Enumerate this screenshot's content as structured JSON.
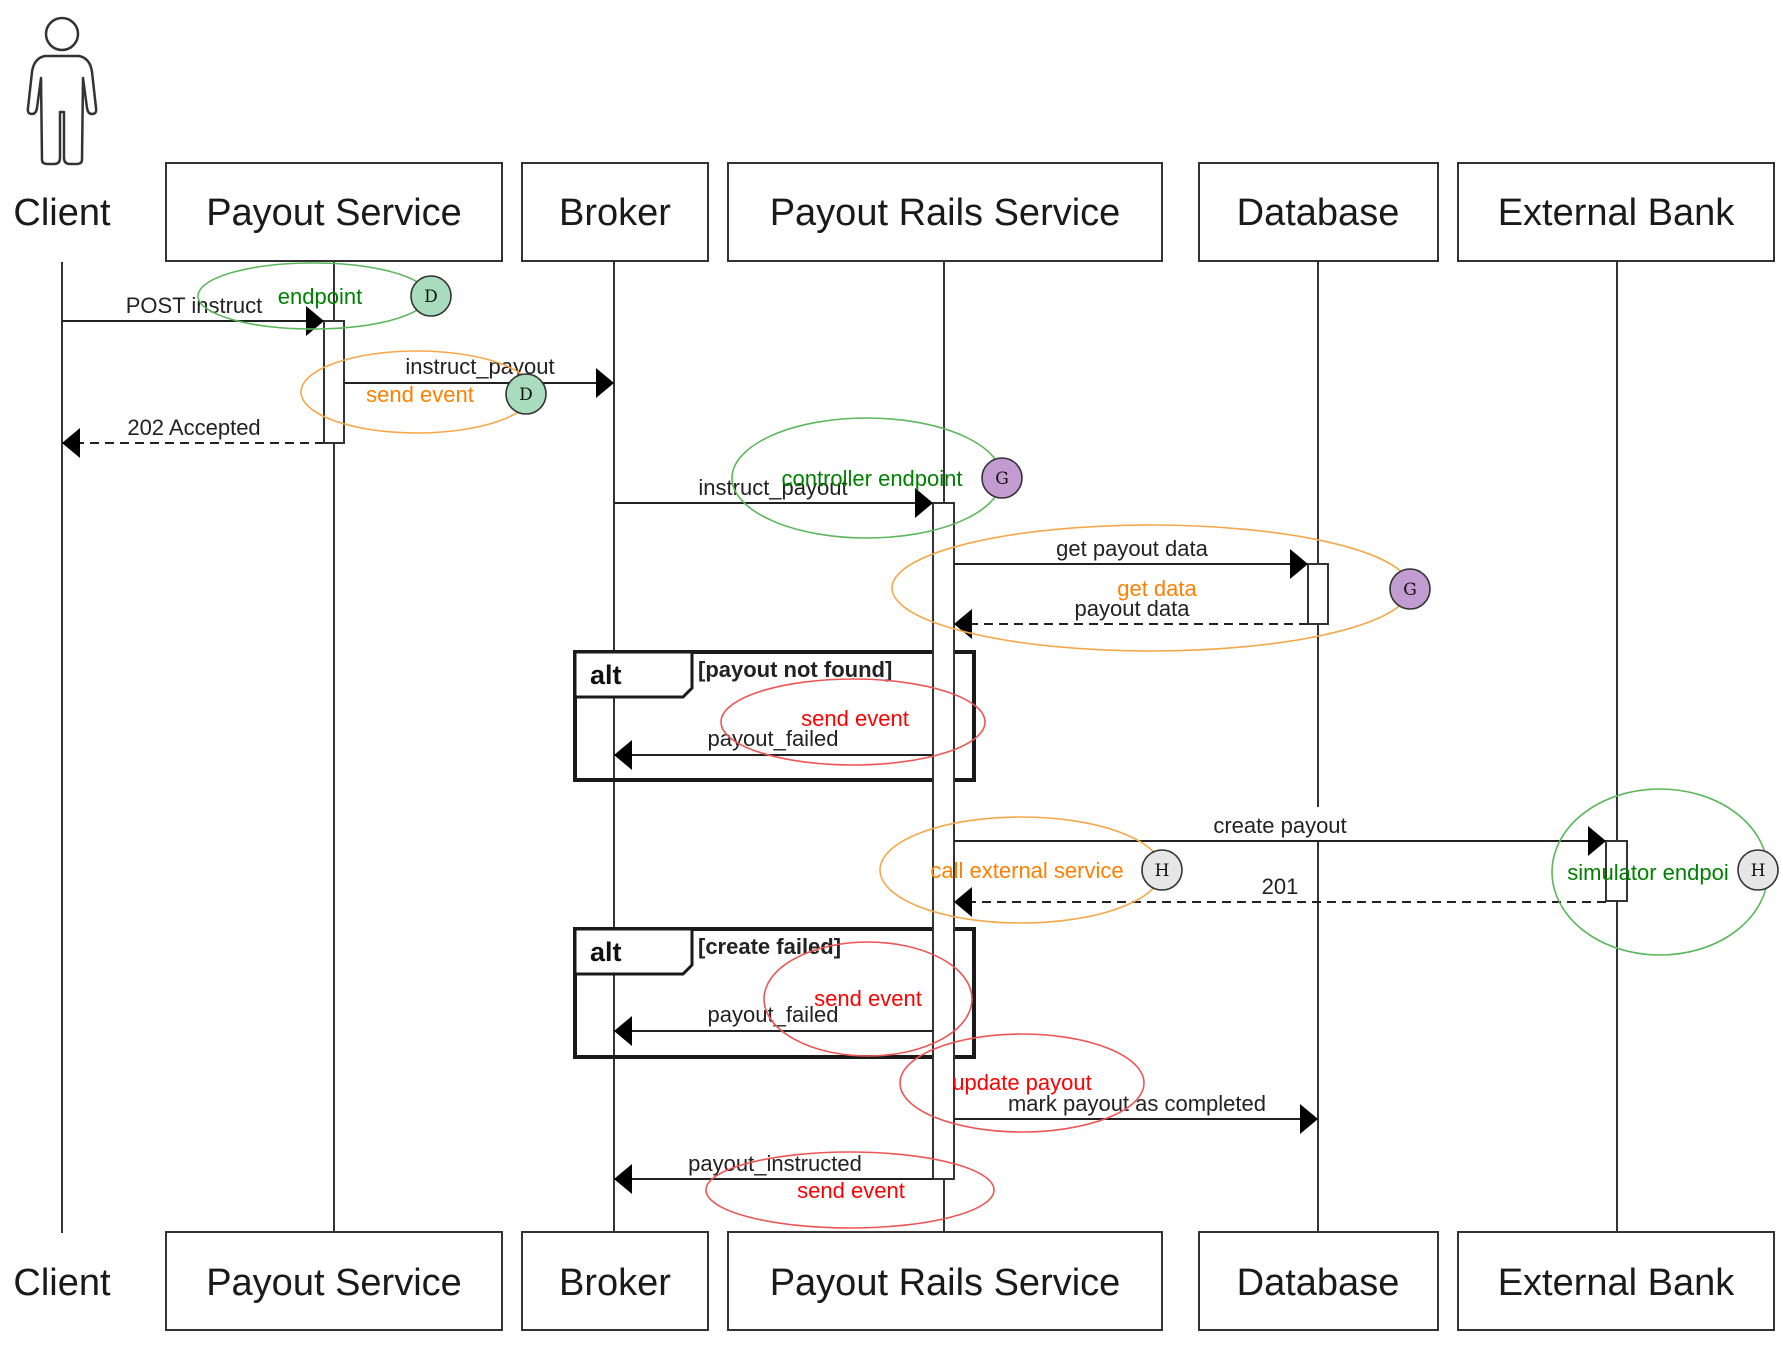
{
  "diagram": {
    "type": "sequence",
    "participants": [
      {
        "id": "client",
        "label": "Client",
        "kind": "actor"
      },
      {
        "id": "payout_service",
        "label": "Payout Service",
        "kind": "box"
      },
      {
        "id": "broker",
        "label": "Broker",
        "kind": "box"
      },
      {
        "id": "payout_rails",
        "label": "Payout Rails Service",
        "kind": "box"
      },
      {
        "id": "database",
        "label": "Database",
        "kind": "box"
      },
      {
        "id": "external_bank",
        "label": "External Bank",
        "kind": "box"
      }
    ],
    "messages": [
      {
        "from": "client",
        "to": "payout_service",
        "label": "POST instruct",
        "style": "solid"
      },
      {
        "from": "payout_service",
        "to": "broker",
        "label": "instruct_payout",
        "style": "solid"
      },
      {
        "from": "payout_service",
        "to": "client",
        "label": "202 Accepted",
        "style": "dashed"
      },
      {
        "from": "broker",
        "to": "payout_rails",
        "label": "instruct_payout",
        "style": "solid"
      },
      {
        "from": "payout_rails",
        "to": "database",
        "label": "get payout data",
        "style": "solid"
      },
      {
        "from": "database",
        "to": "payout_rails",
        "label": "payout data",
        "style": "dashed"
      },
      {
        "from": "payout_rails",
        "to": "broker",
        "label": "payout_failed",
        "style": "solid",
        "frame": 0
      },
      {
        "from": "payout_rails",
        "to": "external_bank",
        "label": "create payout",
        "style": "solid"
      },
      {
        "from": "external_bank",
        "to": "payout_rails",
        "label": "201",
        "style": "dashed"
      },
      {
        "from": "payout_rails",
        "to": "broker",
        "label": "payout_failed",
        "style": "solid",
        "frame": 1
      },
      {
        "from": "payout_rails",
        "to": "database",
        "label": "mark payout as completed",
        "style": "solid"
      },
      {
        "from": "payout_rails",
        "to": "broker",
        "label": "payout_instructed",
        "style": "solid"
      }
    ],
    "frames": [
      {
        "operator": "alt",
        "guard": "[payout not found]"
      },
      {
        "operator": "alt",
        "guard": "[create failed]"
      }
    ],
    "annotations": [
      {
        "text": "endpoint",
        "color": "#008000",
        "ring_color": "#5cb85c",
        "badge": "D"
      },
      {
        "text": "send event",
        "color": "#ff8000",
        "ring_color": "#f5a84a",
        "badge": "D"
      },
      {
        "text": "controller endpoint",
        "color": "#008000",
        "ring_color": "#5cb85c",
        "badge": "G"
      },
      {
        "text": "get data",
        "color": "#ff8000",
        "ring_color": "#f5a84a",
        "badge": "G"
      },
      {
        "text": "send event",
        "color": "#ff0000",
        "ring_color": "#ee5555",
        "badge": null
      },
      {
        "text": "call external service",
        "color": "#ff8000",
        "ring_color": "#f5a84a",
        "badge": "H"
      },
      {
        "text": "simulator endpoi",
        "color": "#008000",
        "ring_color": "#5cb85c",
        "badge": "H"
      },
      {
        "text": "send event",
        "color": "#ff0000",
        "ring_color": "#ee5555",
        "badge": null
      },
      {
        "text": "update payout",
        "color": "#ff0000",
        "ring_color": "#ee5555",
        "badge": null
      },
      {
        "text": "send event",
        "color": "#ff0000",
        "ring_color": "#ee5555",
        "badge": null
      }
    ],
    "badge_colors": {
      "D": "#a8dcbc",
      "G": "#c29bd0",
      "H": "#e6e6e6"
    }
  }
}
